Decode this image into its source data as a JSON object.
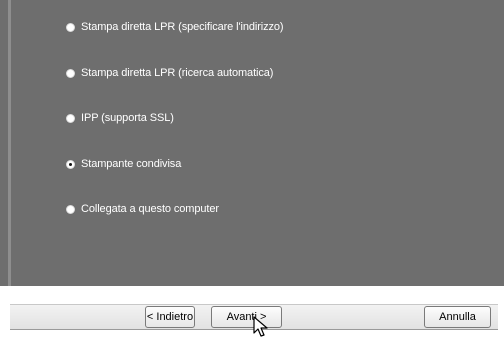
{
  "options": [
    {
      "label": "Stampa diretta LPR (specificare l'indirizzo)",
      "checked": false
    },
    {
      "label": "Stampa diretta LPR (ricerca automatica)",
      "checked": false
    },
    {
      "label": "IPP (supporta SSL)",
      "checked": false
    },
    {
      "label": "Stampante condivisa",
      "checked": true
    },
    {
      "label": "Collegata a questo computer",
      "checked": false
    }
  ],
  "buttons": {
    "back_label": "< Indietro",
    "next_label": "Avanti >",
    "cancel_label": "Annulla"
  }
}
